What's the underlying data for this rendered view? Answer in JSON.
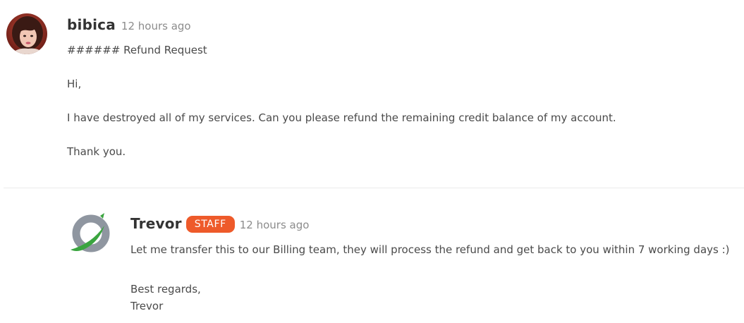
{
  "comments": [
    {
      "author": "bibica",
      "time": "12 hours ago",
      "avatar_icon": "user-photo-avatar",
      "paragraphs": [
        "###### Refund Request",
        "Hi,",
        "I have destroyed all of my services. Can you please refund the remaining credit balance of my account.",
        "Thank you."
      ]
    },
    {
      "author": "Trevor",
      "badge": "STAFF",
      "time": "12 hours ago",
      "avatar_icon": "company-logo-avatar",
      "paragraphs": [
        "Let me transfer this to our Billing team, they will process the refund and get back to you within 7 working days :)",
        "Best regards,",
        "Trevor"
      ]
    }
  ],
  "colors": {
    "badge_bg": "#ee5a2a",
    "author_text": "#333333",
    "timestamp_text": "#8c8c8c",
    "body_text": "#4a4a4a",
    "divider": "#ececec",
    "logo_green": "#3aa53f",
    "logo_grey": "#8f96a0"
  }
}
